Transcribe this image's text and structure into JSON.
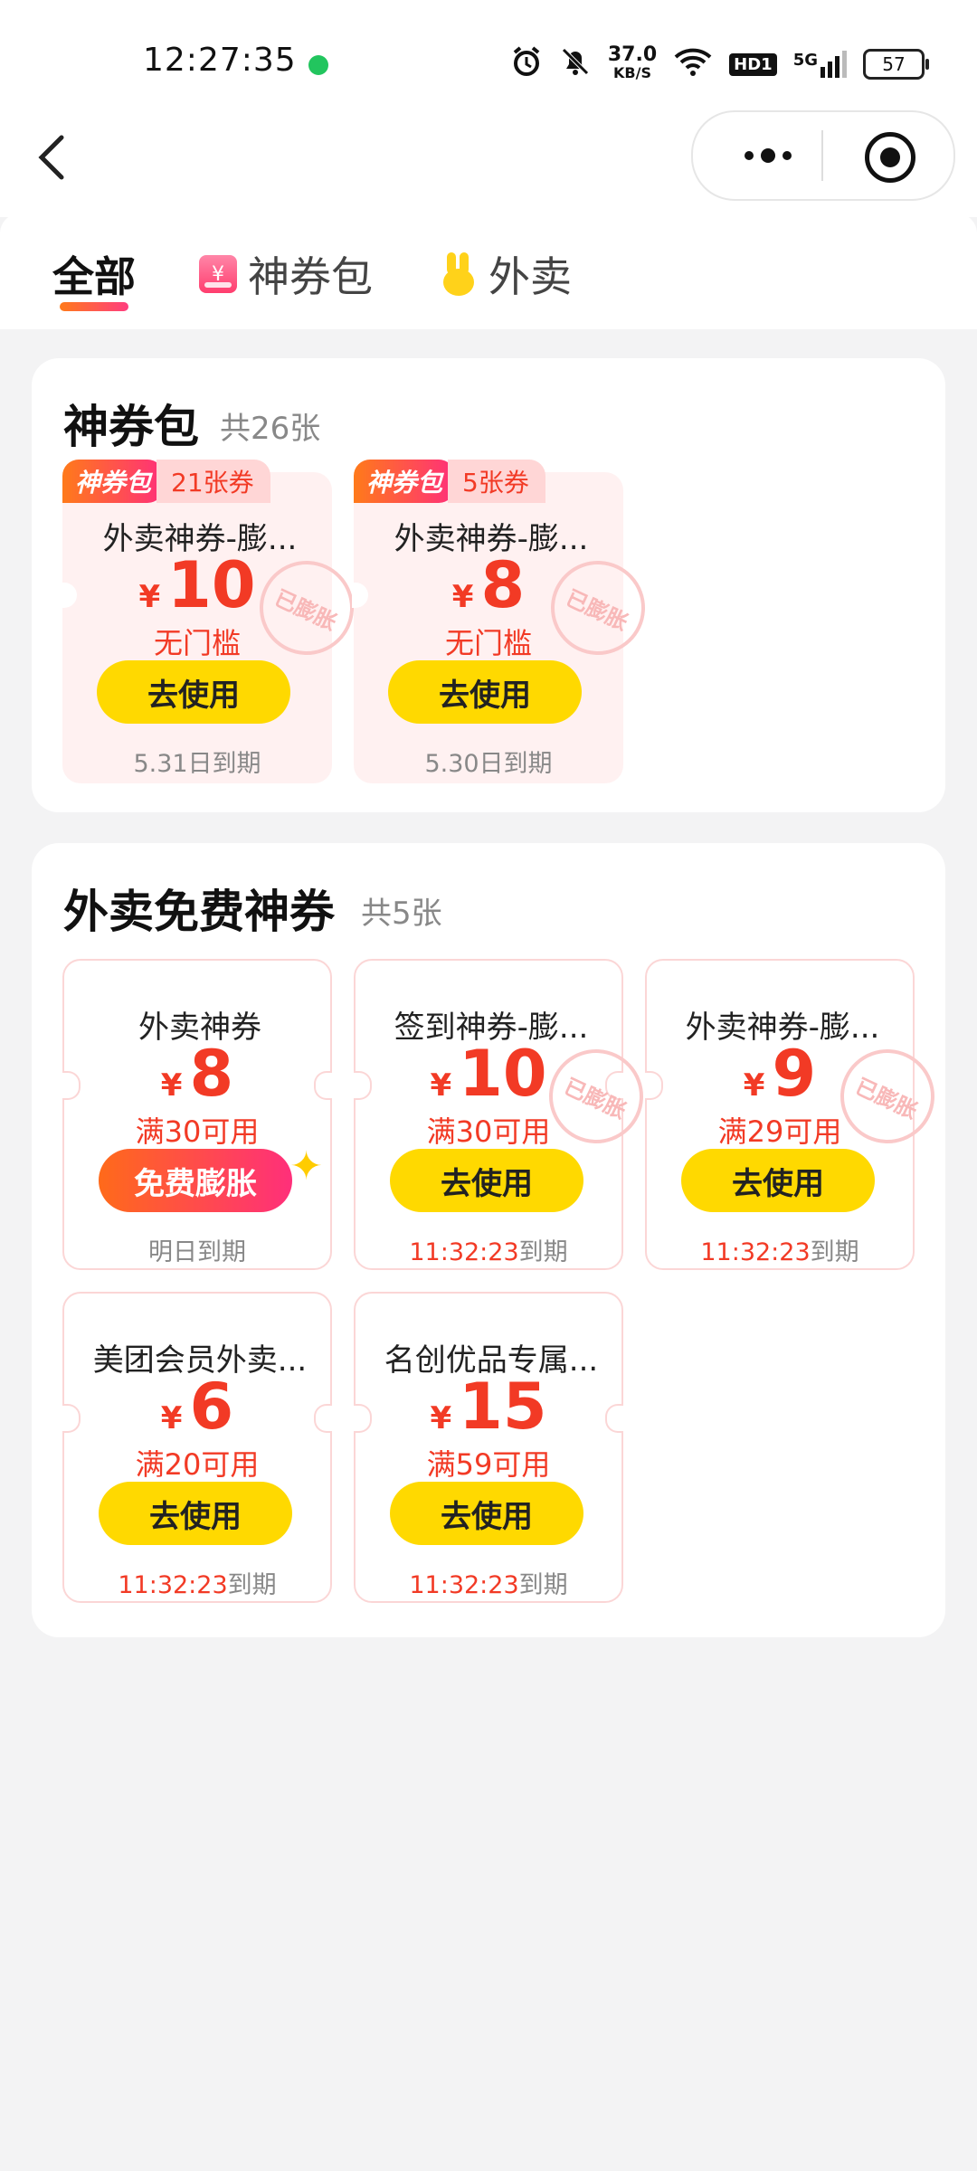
{
  "status_bar": {
    "time": "12:27:35",
    "net_speed": "37.0",
    "net_unit": "KB/S",
    "hd": "HD1",
    "signal": "5G",
    "battery": "57"
  },
  "tabs": [
    {
      "label": "全部"
    },
    {
      "label": "神券包"
    },
    {
      "label": "外卖"
    }
  ],
  "packs": {
    "title": "神券包",
    "count": "共26张",
    "cards": [
      {
        "badge": "神券包",
        "badge_count": "21张券",
        "name": "外卖神券-膨...",
        "yen": "¥",
        "amount": "10",
        "cond": "无门槛",
        "button": "去使用",
        "expire": "5.31日到期",
        "stamp": "已膨胀"
      },
      {
        "badge": "神券包",
        "badge_count": "5张券",
        "name": "外卖神券-膨...",
        "yen": "¥",
        "amount": "8",
        "cond": "无门槛",
        "button": "去使用",
        "expire": "5.30日到期",
        "stamp": "已膨胀"
      }
    ]
  },
  "free": {
    "title": "外卖免费神券",
    "count": "共5张",
    "cards": [
      {
        "name": "外卖神券",
        "yen": "¥",
        "amount": "8",
        "cond": "满30可用",
        "button": "免费膨胀",
        "expire": "明日到期"
      },
      {
        "name": "签到神券-膨...",
        "yen": "¥",
        "amount": "10",
        "cond": "满30可用",
        "button": "去使用",
        "expire_time": "11:32:23",
        "expire_suffix": "到期",
        "stamp": "已膨胀"
      },
      {
        "name": "外卖神券-膨...",
        "yen": "¥",
        "amount": "9",
        "cond": "满29可用",
        "button": "去使用",
        "expire_time": "11:32:23",
        "expire_suffix": "到期",
        "stamp": "已膨胀"
      },
      {
        "name": "美团会员外卖...",
        "yen": "¥",
        "amount": "6",
        "cond": "满20可用",
        "button": "去使用",
        "expire_time": "11:32:23",
        "expire_suffix": "到期"
      },
      {
        "name": "名创优品专属...",
        "yen": "¥",
        "amount": "15",
        "cond": "满59可用",
        "button": "去使用",
        "expire_time": "11:32:23",
        "expire_suffix": "到期"
      }
    ]
  }
}
